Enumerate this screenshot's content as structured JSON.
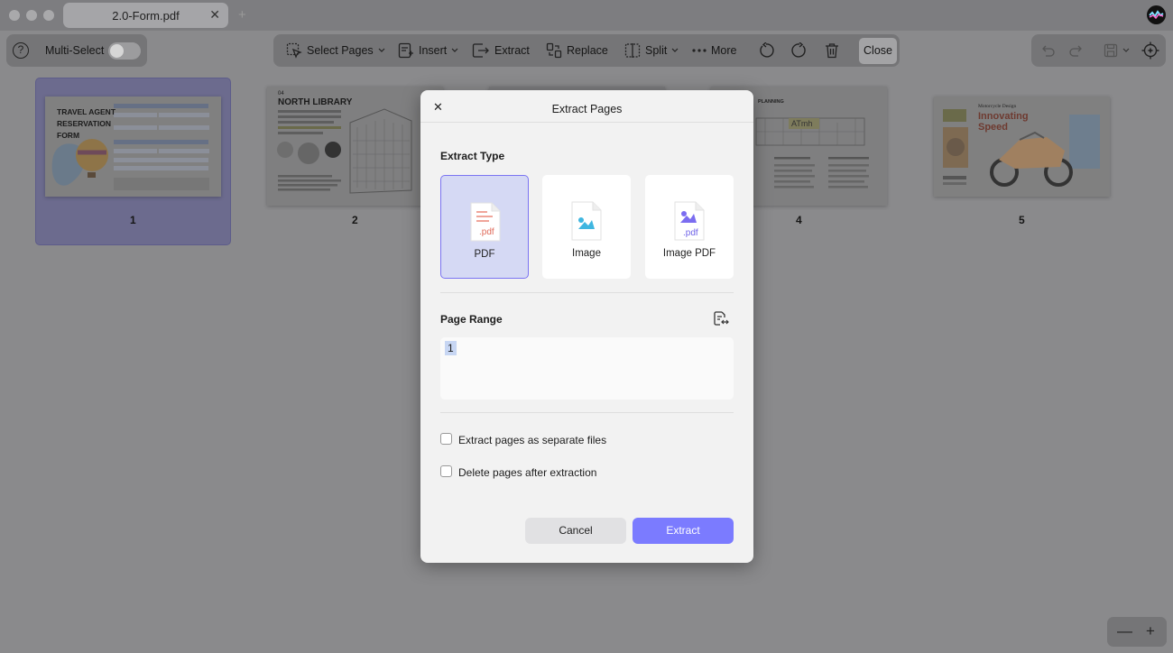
{
  "window": {
    "tab_title": "2.0-Form.pdf",
    "tab_close": "✕",
    "new_tab": "+"
  },
  "toolbar_left": {
    "help": "?",
    "multi_select_label": "Multi-Select",
    "multi_select_on": false
  },
  "toolbar_main": {
    "select_pages": "Select Pages",
    "insert": "Insert",
    "extract": "Extract",
    "replace": "Replace",
    "split": "Split",
    "more": "More",
    "close": "Close"
  },
  "pages": [
    {
      "number": "1",
      "selected": true,
      "text_lines": [
        "TRAVEL AGENT",
        "RESERVATION",
        "FORM"
      ]
    },
    {
      "number": "2",
      "selected": false,
      "text_lines": [
        "04",
        "NORTH LIBRARY"
      ]
    },
    {
      "number": "4",
      "selected": false,
      "text_lines": [
        "PLANNING",
        "ATmh"
      ]
    },
    {
      "number": "5",
      "selected": false,
      "text_lines": [
        "Motorcycle Design",
        "Innovating",
        "Speed"
      ]
    }
  ],
  "dialog": {
    "close_icon": "✕",
    "title": "Extract Pages",
    "extract_type_label": "Extract Type",
    "options": [
      {
        "label": "PDF",
        "icon": "pdf-file-icon",
        "selected": true,
        "badge": ".pdf"
      },
      {
        "label": "Image",
        "icon": "image-file-icon",
        "selected": false,
        "badge": ""
      },
      {
        "label": "Image PDF",
        "icon": "image-pdf-file-icon",
        "selected": false,
        "badge": ".pdf"
      }
    ],
    "page_range_label": "Page Range",
    "page_range_value": "1",
    "checkbox_separate": "Extract pages as separate files",
    "checkbox_delete": "Delete pages after extraction",
    "cancel": "Cancel",
    "extract": "Extract"
  },
  "zoom": {
    "minus": "—",
    "plus": "+"
  },
  "colors": {
    "accent": "#7b7bff",
    "selected_option_border": "#7b74f2",
    "selected_thumb": "#6c6b8e"
  }
}
